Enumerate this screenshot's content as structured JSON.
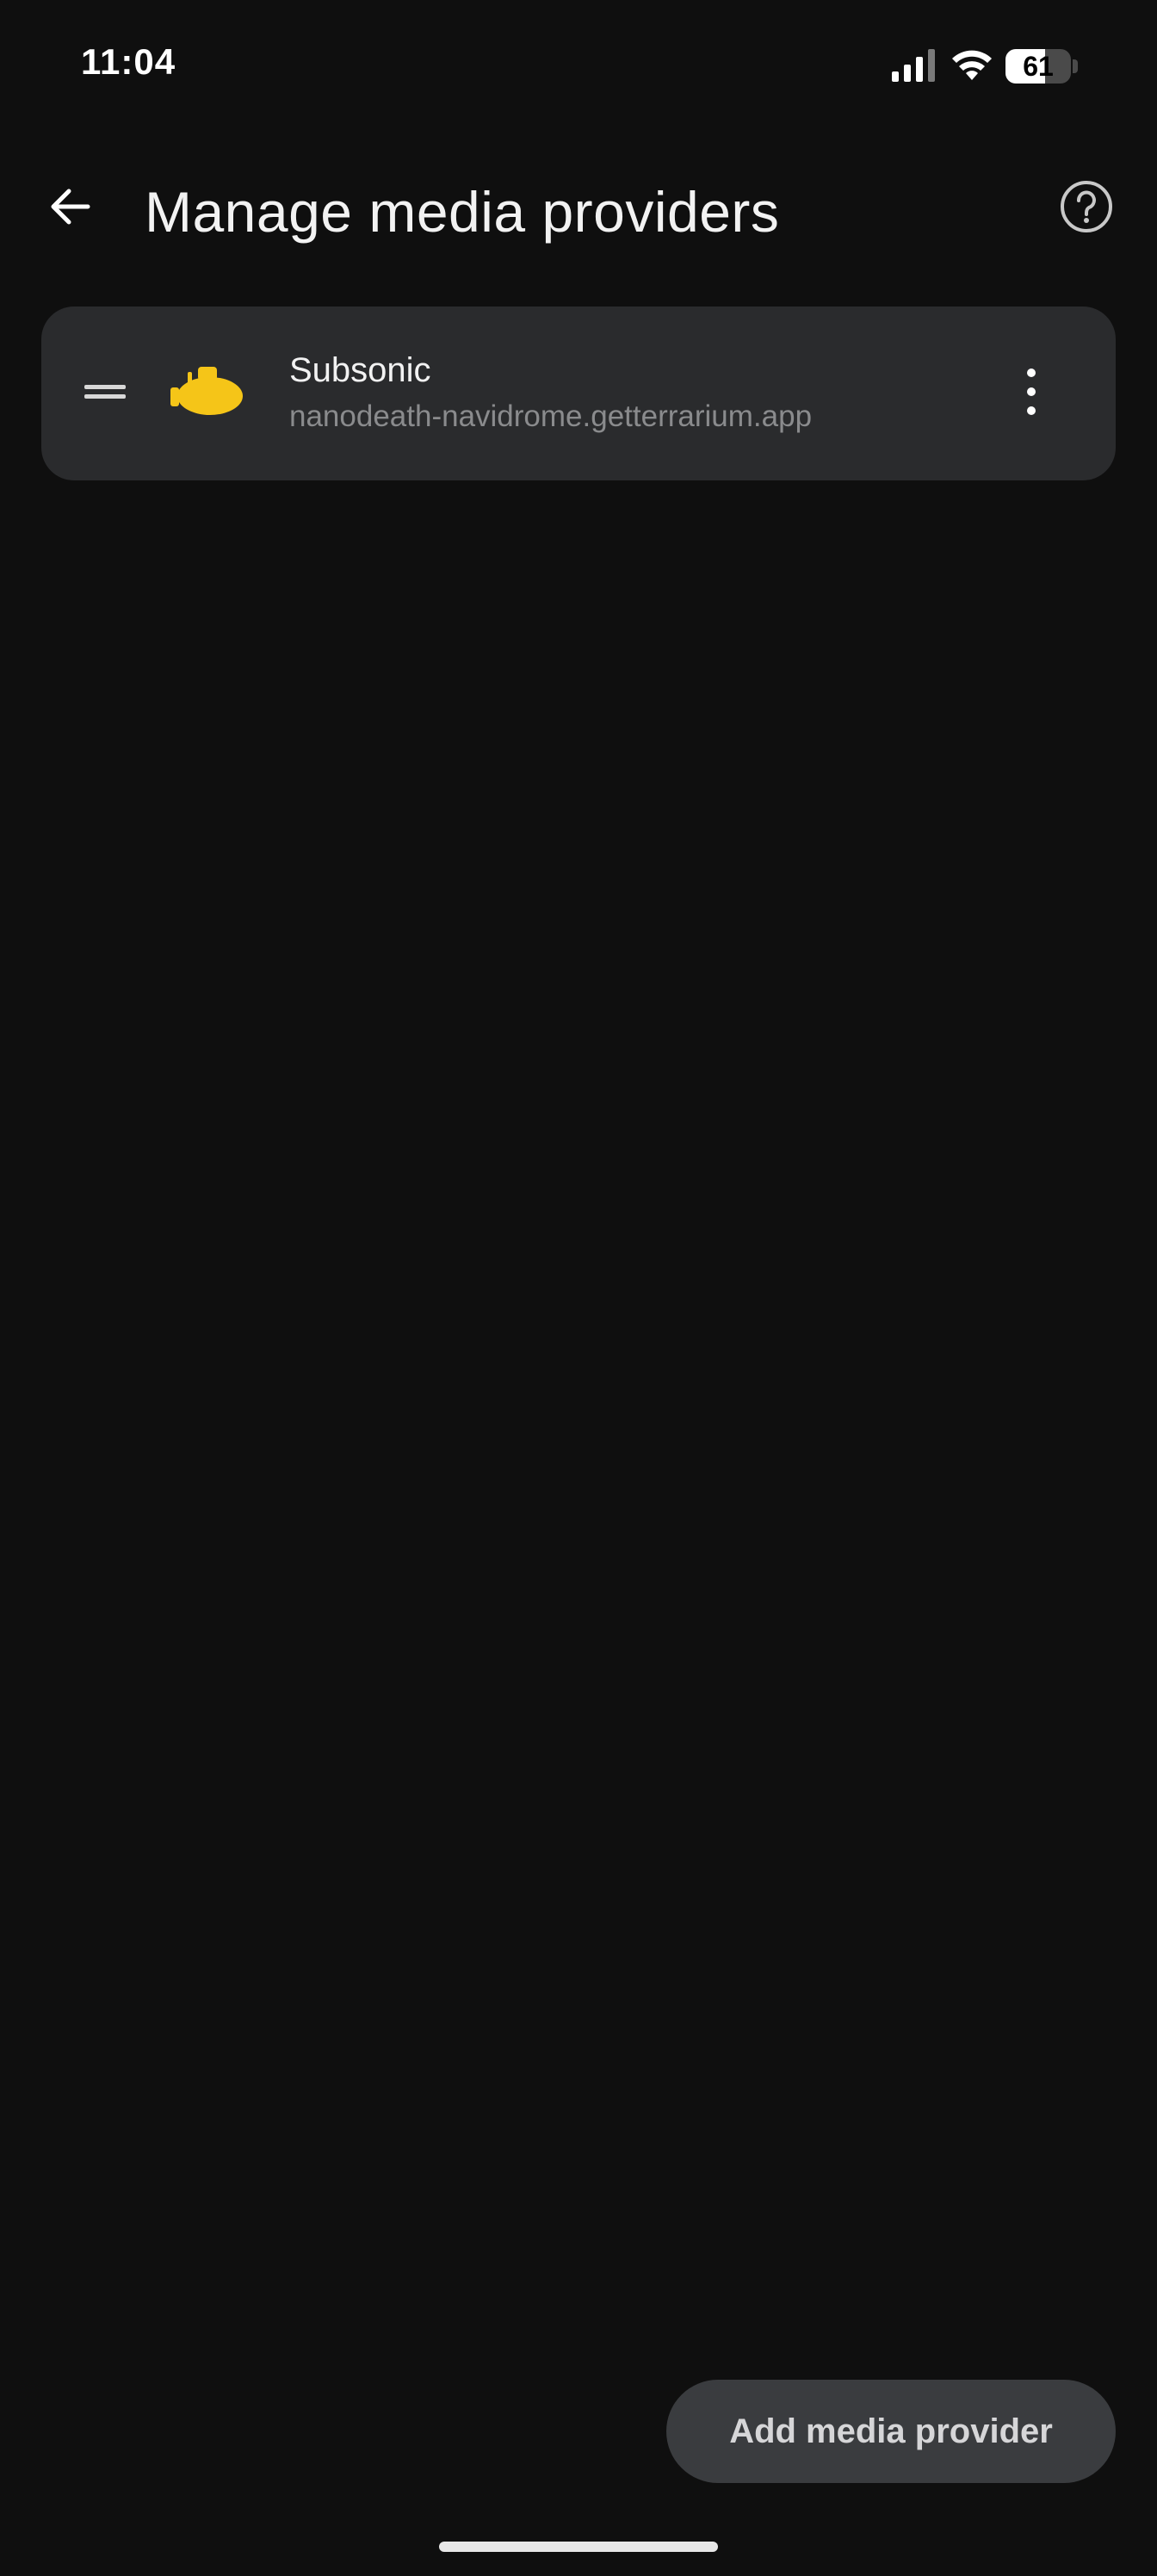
{
  "status_bar": {
    "time": "11:04",
    "battery_level": "61",
    "battery_fraction": 0.61
  },
  "app_bar": {
    "title": "Manage media providers",
    "back_icon": "arrow-back-icon",
    "help_icon": "help-circle-icon"
  },
  "providers": [
    {
      "name": "Subsonic",
      "url": "nanodeath-navidrome.getterrarium.app",
      "icon": "submarine-icon",
      "icon_color": "#f5c518"
    }
  ],
  "fab": {
    "label": "Add media provider"
  },
  "colors": {
    "background": "#0f0f0f",
    "card": "#2a2b2d",
    "fab": "#3a3c3f",
    "accent": "#f5c518"
  }
}
